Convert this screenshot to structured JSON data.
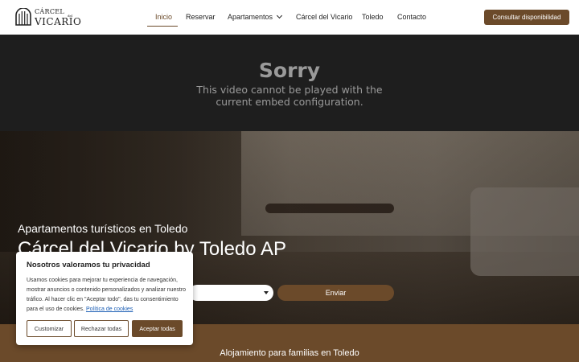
{
  "brand": {
    "logo_top": "CÁRCEL",
    "logo_mid": "del",
    "logo_bottom": "VICARIO"
  },
  "nav": {
    "items": [
      {
        "label": "Inicio",
        "active": true
      },
      {
        "label": "Reservar"
      },
      {
        "label": "Apartamentos",
        "has_dropdown": true
      },
      {
        "label": "Cárcel del Vicario"
      },
      {
        "label": "Toledo"
      },
      {
        "label": "Contacto"
      }
    ],
    "cta_label": "Consultar disponibilidad"
  },
  "video": {
    "title": "Sorry",
    "message_line1": "This video cannot be played with the",
    "message_line2": "current embed configuration."
  },
  "hero": {
    "subtitle": "Apartamentos turísticos en Toledo",
    "title": "Cárcel del Vicario by Toledo AP",
    "send_label": "Enviar"
  },
  "band": {
    "text": "Alojamiento para familias en Toledo"
  },
  "cookie": {
    "title": "Nosotros valoramos tu privacidad",
    "body": "Usamos cookies para mejorar tu experiencia de navegación, mostrar anuncios o contenido personalizados y analizar nuestro tráfico. Al hacer clic en \"Aceptar todo\", das tu consentimiento para el uso de cookies.",
    "link_label": "Política de cookies",
    "customize_label": "Customizar",
    "reject_label": "Rechazar todas",
    "accept_label": "Aceptar todas"
  },
  "colors": {
    "accent": "#6b4a2a",
    "header_bg": "#ffffff",
    "video_bg": "#1e1e1e"
  }
}
